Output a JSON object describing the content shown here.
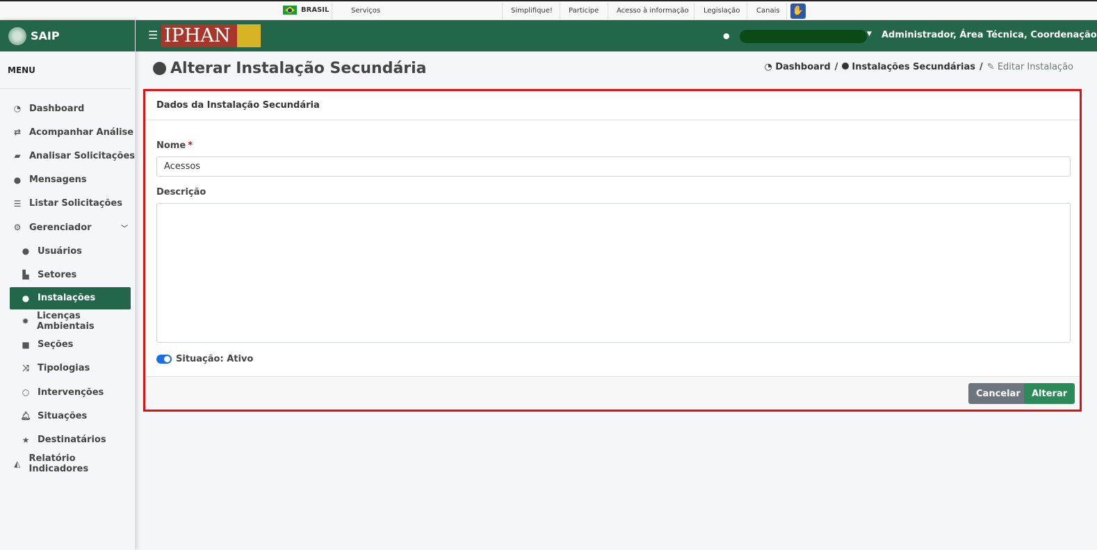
{
  "govbar": {
    "country": "BRASIL",
    "links": [
      "Serviços",
      "Simplifique!",
      "Participe",
      "Acesso à informação",
      "Legislação",
      "Canais"
    ]
  },
  "sidebar": {
    "brand": "SAIP",
    "menu_title": "MENU",
    "items": [
      {
        "label": "Dashboard",
        "icon": "tachometer-icon"
      },
      {
        "label": "Acompanhar Análise",
        "icon": "exchange-icon"
      },
      {
        "label": "Analisar Solicitações",
        "icon": "book-icon"
      },
      {
        "label": "Mensagens",
        "icon": "comments-icon"
      },
      {
        "label": "Listar Solicitações",
        "icon": "list-icon"
      },
      {
        "label": "Gerenciador",
        "icon": "cogs-icon"
      },
      {
        "label": "Usuários",
        "icon": "users-icon"
      },
      {
        "label": "Setores",
        "icon": "industry-icon"
      },
      {
        "label": "Instalações",
        "icon": "circle-icon"
      },
      {
        "label": "Licenças Ambientais",
        "icon": "certificate-icon"
      },
      {
        "label": "Seções",
        "icon": "square-icon"
      },
      {
        "label": "Tipologias",
        "icon": "random-icon"
      },
      {
        "label": "Intervenções",
        "icon": "circle-notch-icon"
      },
      {
        "label": "Situações",
        "icon": "bell-icon"
      },
      {
        "label": "Destinatários",
        "icon": "star-icon"
      },
      {
        "label": "Relatório Indicadores",
        "icon": "area-chart-icon"
      }
    ]
  },
  "header": {
    "logo_text": "IPHAN",
    "user_name": "Administrador, Área Técnica, Coordenação..."
  },
  "page": {
    "title": "Alterar Instalação Secundária",
    "breadcrumb": [
      "Dashboard",
      "Instalações Secundárias",
      "Editar Instalação"
    ]
  },
  "form": {
    "card_title": "Dados da Instalação Secundária",
    "nome_label": "Nome",
    "nome_required": "*",
    "nome_value": "Acessos",
    "descricao_label": "Descrição",
    "descricao_value": "",
    "situacao_label": "Situação: Ativo",
    "cancel_label": "Cancelar",
    "submit_label": "Alterar"
  }
}
